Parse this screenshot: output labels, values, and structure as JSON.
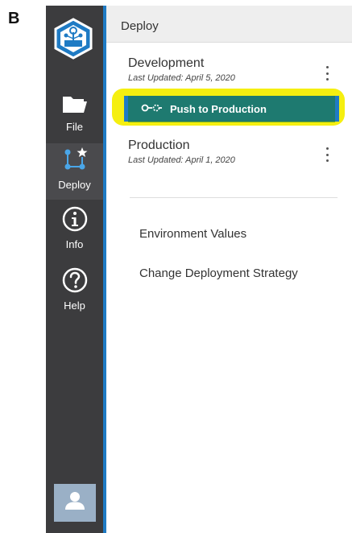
{
  "figure_label": "B",
  "sidebar": {
    "logo_icon": "deploy-network-hexagon-icon",
    "items": [
      {
        "label": "File",
        "icon": "folder-icon",
        "active": false
      },
      {
        "label": "Deploy",
        "icon": "deploy-nodes-icon",
        "active": true
      },
      {
        "label": "Info",
        "icon": "info-circle-icon",
        "active": false
      },
      {
        "label": "Help",
        "icon": "help-circle-icon",
        "active": false
      }
    ],
    "avatar_icon": "user-icon"
  },
  "panel": {
    "title": "Deploy",
    "environments": [
      {
        "name": "Development",
        "updated": "Last Updated: April 5, 2020"
      },
      {
        "name": "Production",
        "updated": "Last Updated: April 1, 2020"
      }
    ],
    "push_button_label": "Push to Production",
    "links": [
      "Environment Values",
      "Change Deployment Strategy"
    ]
  },
  "colors": {
    "sidebar_bg": "#3c3c3e",
    "accent_blue": "#1f7bc4",
    "highlight_yellow": "#f5ef10",
    "overlay_green": "#1d7a2b",
    "avatar_bg": "#9ab0c6"
  }
}
